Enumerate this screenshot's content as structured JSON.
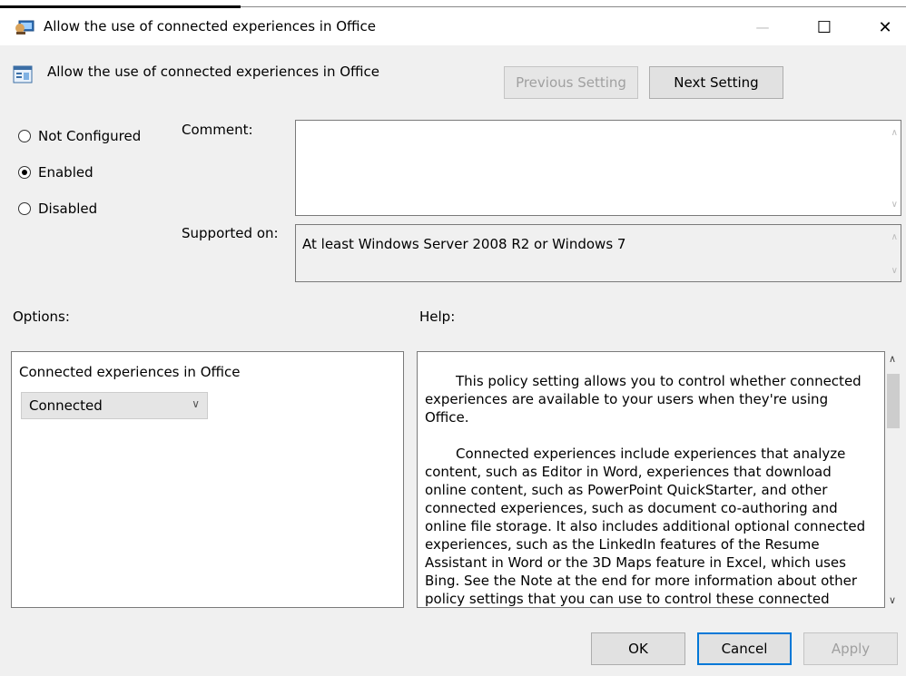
{
  "window": {
    "title": "Allow the use of connected experiences in Office",
    "minimize_glyph": "—",
    "maximize_glyph": "☐",
    "close_glyph": "✕"
  },
  "header": {
    "title": "Allow the use of connected experiences in Office",
    "previous_label": "Previous Setting",
    "next_label": "Next Setting"
  },
  "state": {
    "options": [
      {
        "label": "Not Configured",
        "selected": false
      },
      {
        "label": "Enabled",
        "selected": true
      },
      {
        "label": "Disabled",
        "selected": false
      }
    ]
  },
  "comment": {
    "label": "Comment:",
    "value": ""
  },
  "supported": {
    "label": "Supported on:",
    "value": "At least Windows Server 2008 R2 or Windows 7"
  },
  "options_section": {
    "label": "Options:",
    "field_label": "Connected experiences in Office",
    "selected_value": "Connected"
  },
  "help_section": {
    "label": "Help:",
    "paragraphs": [
      "This policy setting allows you to control whether connected experiences are available to your users when they're using Office.",
      "Connected experiences include experiences that analyze content, such as Editor in Word, experiences that download online content, such as PowerPoint QuickStarter, and other connected experiences, such as document co-authoring and online file storage. It also includes additional optional connected experiences, such as the LinkedIn features of the Resume Assistant in Word or the 3D Maps feature in Excel, which uses Bing. See the Note at the end for more information about other policy settings that you can use to control these connected"
    ]
  },
  "footer": {
    "ok_label": "OK",
    "cancel_label": "Cancel",
    "apply_label": "Apply"
  },
  "colors": {
    "background": "#f0f0f0",
    "accent": "#0078d7",
    "disabled_text": "#a0a0a0"
  }
}
